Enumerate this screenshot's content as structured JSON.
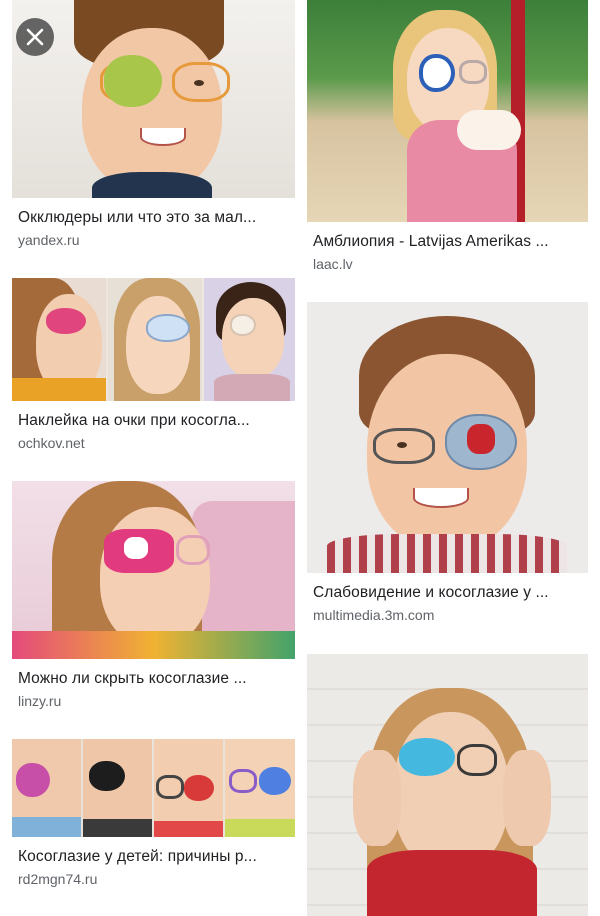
{
  "close_button": {
    "icon": "close-icon",
    "color": "#ffffff"
  },
  "results": {
    "left": [
      {
        "title": "Окклюдеры или что это за мал...",
        "source": "yandex.ru",
        "patch_color": "#a8c64a"
      },
      {
        "title": "Наклейка на очки при косогла...",
        "source": "ochkov.net",
        "patch_color": "#e0457d"
      },
      {
        "title": "Можно ли скрыть косоглазие ...",
        "source": "linzy.ru",
        "patch_color": "#e23a7f"
      },
      {
        "title": "Косоглазие у детей: причины р...",
        "source": "rd2mgn74.ru",
        "patch_color": "#c84fa8"
      }
    ],
    "right": [
      {
        "title": "Амблиопия - Latvijas Amerikas ...",
        "source": "laac.lv",
        "patch_color": "#ffffff"
      },
      {
        "title": "Слабовидение и косоглазие у ...",
        "source": "multimedia.3m.com",
        "patch_color": "#9fb6cf"
      },
      {
        "title": "",
        "source": "",
        "patch_color": "#45b8e0"
      }
    ]
  }
}
